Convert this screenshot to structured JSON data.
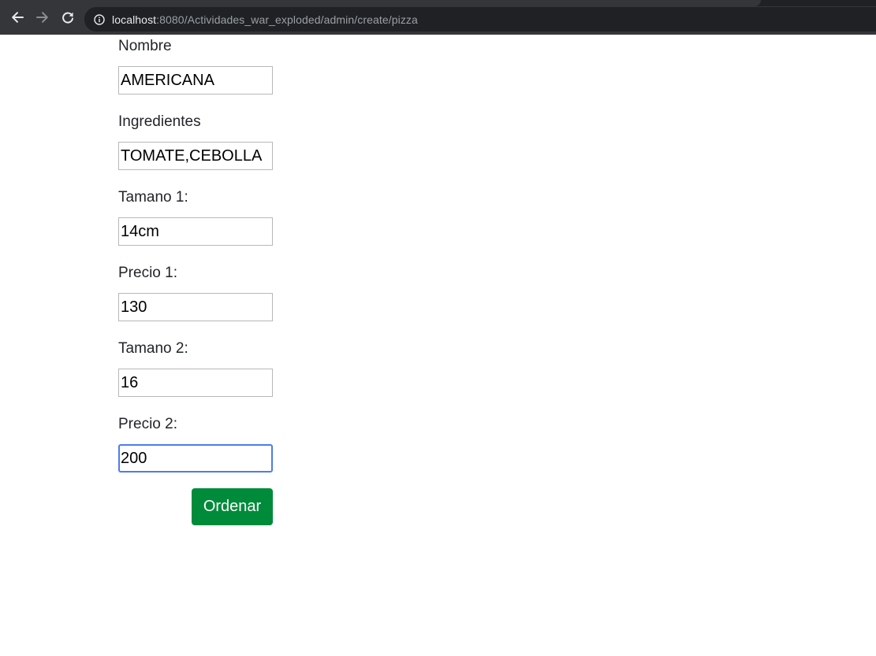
{
  "browser": {
    "url_host": "localhost",
    "url_path": ":8080/Actividades_war_exploded/admin/create/pizza",
    "icons": [
      "back-icon",
      "forward-icon",
      "reload-icon",
      "info-icon"
    ],
    "colors": {
      "toolbar_bg": "#35363a",
      "omnibox_bg": "#202124",
      "host_text": "#e8eaed",
      "path_text": "#9aa0a6"
    }
  },
  "form": {
    "fields": [
      {
        "label": "Nombre",
        "value": "AMERICANA"
      },
      {
        "label": "Ingredientes",
        "value": "TOMATE,CEBOLLA"
      },
      {
        "label": "Tamano 1:",
        "value": "14cm"
      },
      {
        "label": "Precio 1:",
        "value": "130"
      },
      {
        "label": "Tamano 2:",
        "value": "16"
      },
      {
        "label": "Precio 2:",
        "value": "200"
      }
    ],
    "focused_field": "Precio 2:",
    "submit_label": "Ordenar",
    "colors": {
      "submit_bg": "#008b3a",
      "focus_ring": "#4e7bf0"
    }
  }
}
